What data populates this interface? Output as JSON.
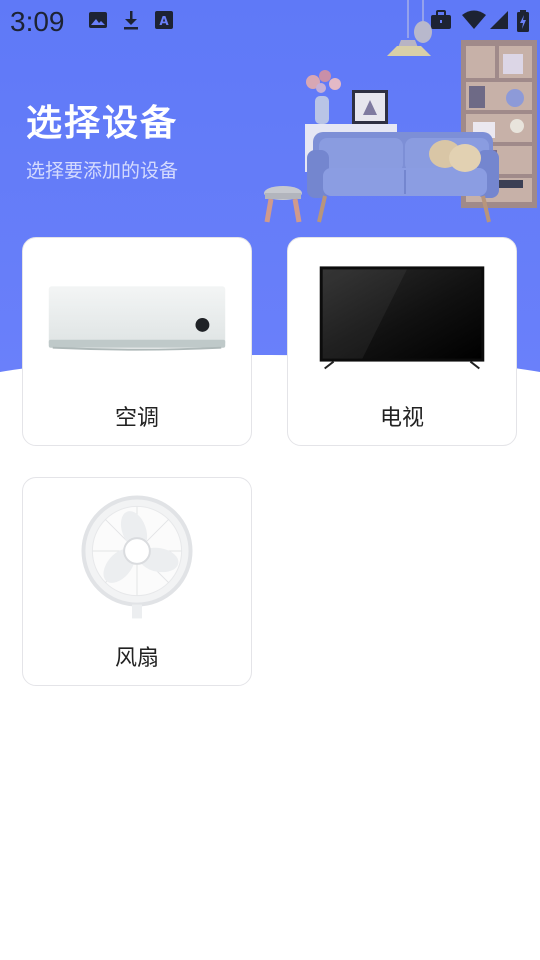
{
  "status_bar": {
    "time": "3:09",
    "left_icons": [
      "image-icon",
      "download-icon",
      "text-a-icon"
    ],
    "right_icons": [
      "briefcase-icon",
      "wifi-icon",
      "signal-icon",
      "battery-icon"
    ]
  },
  "header": {
    "title": "选择设备",
    "subtitle": "选择要添加的设备"
  },
  "colors": {
    "hero_background": "#5f79f7",
    "card_border": "#e4e4e8"
  },
  "devices": [
    {
      "label": "空调",
      "icon": "air-conditioner-icon"
    },
    {
      "label": "电视",
      "icon": "television-icon"
    },
    {
      "label": "风扇",
      "icon": "fan-icon"
    }
  ]
}
